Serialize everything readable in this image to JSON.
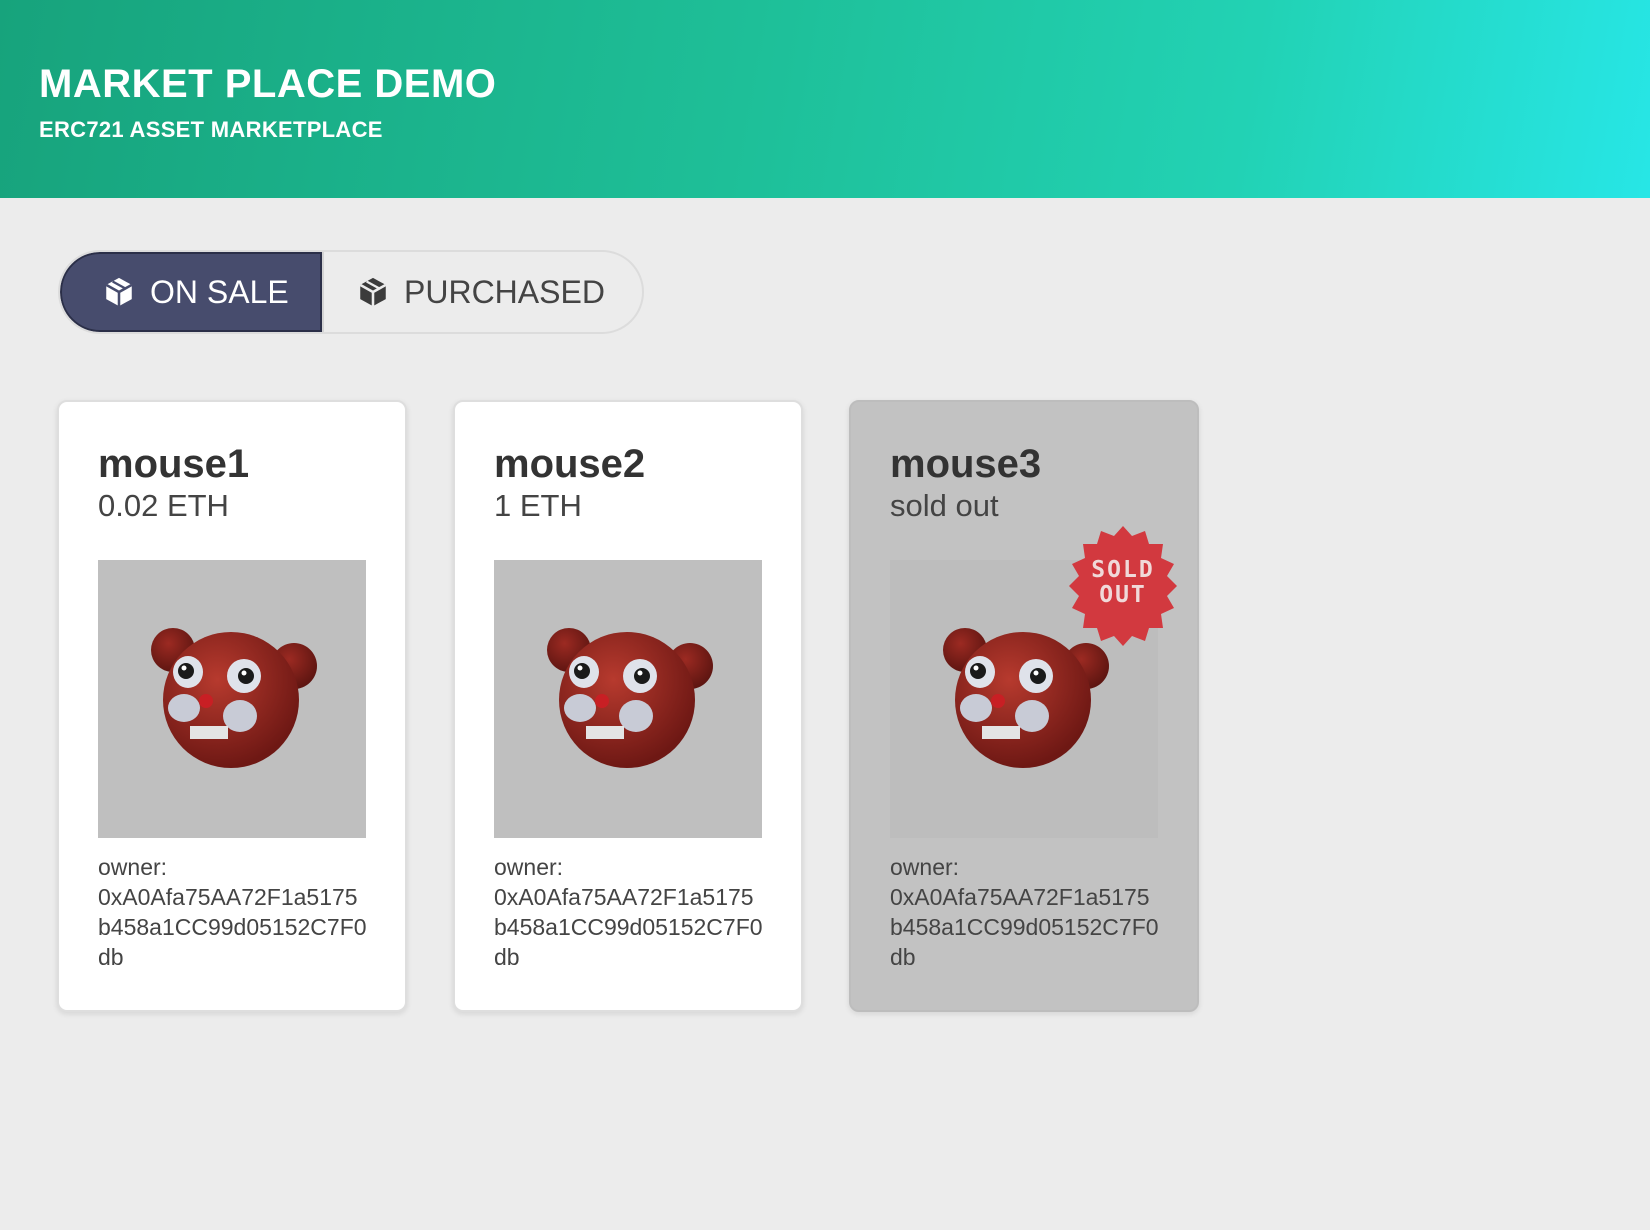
{
  "header": {
    "title": "MARKET PLACE DEMO",
    "subtitle": "ERC721 ASSET MARKETPLACE"
  },
  "tabs": [
    {
      "label": "ON SALE",
      "icon": "cube-icon",
      "active": true
    },
    {
      "label": "PURCHASED",
      "icon": "cube-icon",
      "active": false
    }
  ],
  "colors": {
    "header_gradient": [
      "#17a37c",
      "#27e6e6"
    ],
    "active_tab": "#474c6d",
    "sold_badge": "#d2393f"
  },
  "items": [
    {
      "name": "mouse1",
      "price": "0.02 ETH",
      "owner_label": "owner:",
      "owner": "0xA0Afa75AA72F1a5175b458a1CC99d05152C7F0db",
      "sold": false
    },
    {
      "name": "mouse2",
      "price": "1 ETH",
      "owner_label": "owner:",
      "owner": "0xA0Afa75AA72F1a5175b458a1CC99d05152C7F0db",
      "sold": false
    },
    {
      "name": "mouse3",
      "price": "sold out",
      "owner_label": "owner:",
      "owner": "0xA0Afa75AA72F1a5175b458a1CC99d05152C7F0db",
      "sold": true,
      "badge_line1": "SOLD",
      "badge_line2": "OUT"
    }
  ]
}
